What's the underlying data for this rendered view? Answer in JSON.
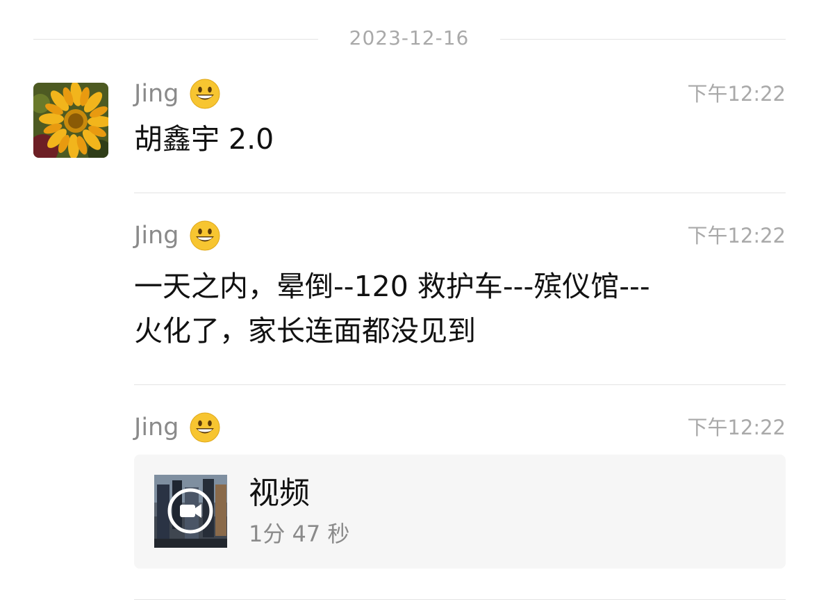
{
  "date_divider": "2023-12-16",
  "messages": [
    {
      "sender": "Jing",
      "emoji": "grinning-face-icon",
      "time": "下午12:22",
      "text": "胡鑫宇 2.0"
    },
    {
      "sender": "Jing",
      "emoji": "grinning-face-icon",
      "time": "下午12:22",
      "text_line1": "一天之内，晕倒--120 救护车---殡仪馆---",
      "text_line2": "火化了，家长连面都没见到"
    },
    {
      "sender": "Jing",
      "emoji": "grinning-face-icon",
      "time": "下午12:22",
      "video": {
        "title": "视频",
        "duration": "1分 47 秒",
        "icon": "video-camera-icon"
      }
    }
  ],
  "colors": {
    "meta_text": "#a9a9a9",
    "name_text": "#8a8a8a",
    "body_text": "#111111",
    "divider": "#e3e3e3",
    "card_bg": "#f6f6f6"
  }
}
